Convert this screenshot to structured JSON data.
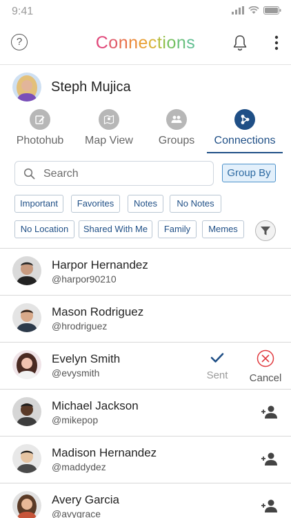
{
  "status_bar": {
    "time": "9:41"
  },
  "nav": {
    "title_letters": [
      {
        "ch": "C",
        "color": "#e0487a"
      },
      {
        "ch": "o",
        "color": "#e05c6a"
      },
      {
        "ch": "n",
        "color": "#e8704a"
      },
      {
        "ch": "n",
        "color": "#eb8a3a"
      },
      {
        "ch": "e",
        "color": "#e8a035"
      },
      {
        "ch": "c",
        "color": "#d9b338"
      },
      {
        "ch": "t",
        "color": "#b6bd3e"
      },
      {
        "ch": "i",
        "color": "#8fc049"
      },
      {
        "ch": "o",
        "color": "#76c161"
      },
      {
        "ch": "n",
        "color": "#6bc07c"
      },
      {
        "ch": "s",
        "color": "#62bf92"
      }
    ],
    "help_label": "?"
  },
  "profile": {
    "name": "Steph Mujica"
  },
  "tabs": [
    {
      "label": "Photohub",
      "icon": "edit-icon"
    },
    {
      "label": "Map View",
      "icon": "map-icon"
    },
    {
      "label": "Groups",
      "icon": "group-icon"
    },
    {
      "label": "Connections",
      "icon": "connections-icon",
      "active": true
    }
  ],
  "search": {
    "placeholder": "Search",
    "value": ""
  },
  "group_by": {
    "label": "Group By"
  },
  "filters_row1": [
    "Important",
    "Favorites",
    "Notes",
    "No Notes"
  ],
  "filters_row2": [
    "No Location",
    "Shared With Me",
    "Family",
    "Memes"
  ],
  "connections": [
    {
      "name": "Harpor Hernandez",
      "handle": "@harpor90210",
      "action": "none"
    },
    {
      "name": "Mason Rodriguez",
      "handle": "@hrodriguez",
      "action": "none"
    },
    {
      "name": "Evelyn Smith",
      "handle": "@evysmith",
      "action": "sent"
    },
    {
      "name": "Michael Jackson",
      "handle": "@mikepop",
      "action": "add"
    },
    {
      "name": "Madison Hernandez",
      "handle": "@maddydez",
      "action": "add"
    },
    {
      "name": "Avery Garcia",
      "handle": "@avygrace",
      "action": "add"
    }
  ],
  "actions": {
    "sent_label": "Sent",
    "cancel_label": "Cancel"
  },
  "colors": {
    "accent": "#1f4f86",
    "cancel": "#e0393e",
    "chip_text": "#1f4f86"
  }
}
